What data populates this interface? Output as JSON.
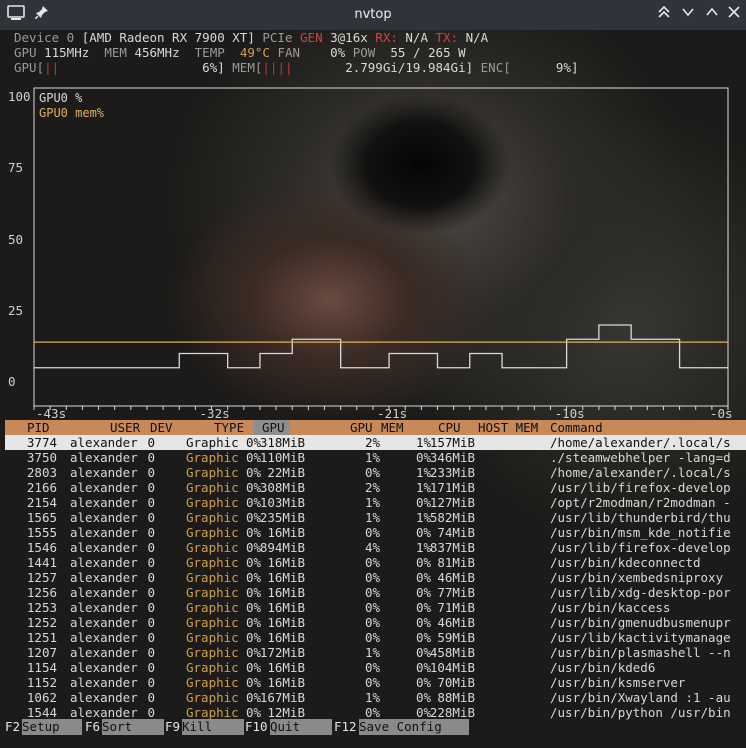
{
  "window": {
    "title": "nvtop"
  },
  "device": {
    "line1": {
      "device": "Device 0",
      "name": "[AMD Radeon RX 7900 XT]",
      "pcie_label": "PCIe",
      "gen_label": "GEN",
      "gen": "3@16x",
      "rx_label": "RX:",
      "rx": "N/A",
      "tx_label": "TX:",
      "tx": "N/A"
    },
    "line2": {
      "gpu_label": "GPU",
      "gpu_clock": "115MHz",
      "mem_label": "MEM",
      "mem_clock": "456MHz",
      "temp_label": "TEMP",
      "temp": "49°C",
      "fan_label": "FAN",
      "fan": "0%",
      "pow_label": "POW",
      "pow": "55 / 265 W"
    },
    "line3": {
      "gpu_label": "GPU[",
      "gpu_bar": "||",
      "gpu_pct": "6%]",
      "mem_label": "MEM[",
      "mem_bar": "||||",
      "mem_val": "2.799Gi/19.984Gi]",
      "enc_label": "ENC[",
      "enc_pct": "9%]"
    }
  },
  "chart_data": {
    "type": "line",
    "y_ticks": [
      "100",
      "75",
      "50",
      "25",
      "0"
    ],
    "x_ticks": [
      "-43s",
      "-32s",
      "-21s",
      "-10s",
      "-0s"
    ],
    "ylim": [
      0,
      100
    ],
    "series": [
      {
        "name": "GPU0 %",
        "color": "#d9d9d9",
        "x": [
          -43,
          -35,
          -34,
          -32,
          -31,
          -30,
          -29,
          -28,
          -27,
          -25,
          -24,
          -22,
          -21,
          -19,
          -18,
          -17,
          -16,
          -15,
          -14,
          -12,
          -10,
          -9,
          -8,
          -7,
          -6,
          -4,
          -3,
          0
        ],
        "values": [
          5,
          5,
          10,
          10,
          5,
          5,
          10,
          10,
          15,
          15,
          5,
          5,
          10,
          10,
          5,
          5,
          10,
          10,
          5,
          5,
          15,
          15,
          20,
          20,
          15,
          15,
          5,
          5
        ]
      },
      {
        "name": "GPU0 mem%",
        "color": "#e0b060",
        "x": [
          -43,
          0
        ],
        "values": [
          14,
          14
        ]
      }
    ]
  },
  "table": {
    "headers": {
      "pid": "PID",
      "user": "USER",
      "dev": "DEV",
      "type": "TYPE",
      "gpu": "GPU",
      "gpu_mem": "GPU",
      "mem": "MEM",
      "cpu": "CPU",
      "host_mem": "HOST MEM",
      "command": "Command"
    },
    "rows": [
      {
        "pid": "3774",
        "user": "alexander",
        "dev": "0",
        "type": "Graphic",
        "gpu": "0%",
        "gpu_mem": "318MiB",
        "mem": "2%",
        "cpu": "1%",
        "host_mem": "157MiB",
        "command": "/home/alexander/.local/s"
      },
      {
        "pid": "3750",
        "user": "alexander",
        "dev": "0",
        "type": "Graphic",
        "gpu": "0%",
        "gpu_mem": "110MiB",
        "mem": "1%",
        "cpu": "0%",
        "host_mem": "346MiB",
        "command": "./steamwebhelper -lang=d"
      },
      {
        "pid": "2803",
        "user": "alexander",
        "dev": "0",
        "type": "Graphic",
        "gpu": "0%",
        "gpu_mem": "22MiB",
        "mem": "0%",
        "cpu": "1%",
        "host_mem": "233MiB",
        "command": "/home/alexander/.local/s"
      },
      {
        "pid": "2166",
        "user": "alexander",
        "dev": "0",
        "type": "Graphic",
        "gpu": "0%",
        "gpu_mem": "308MiB",
        "mem": "2%",
        "cpu": "1%",
        "host_mem": "171MiB",
        "command": "/usr/lib/firefox-develop"
      },
      {
        "pid": "2154",
        "user": "alexander",
        "dev": "0",
        "type": "Graphic",
        "gpu": "0%",
        "gpu_mem": "103MiB",
        "mem": "1%",
        "cpu": "0%",
        "host_mem": "127MiB",
        "command": "/opt/r2modman/r2modman -"
      },
      {
        "pid": "1565",
        "user": "alexander",
        "dev": "0",
        "type": "Graphic",
        "gpu": "0%",
        "gpu_mem": "235MiB",
        "mem": "1%",
        "cpu": "1%",
        "host_mem": "582MiB",
        "command": "/usr/lib/thunderbird/thu"
      },
      {
        "pid": "1555",
        "user": "alexander",
        "dev": "0",
        "type": "Graphic",
        "gpu": "0%",
        "gpu_mem": "16MiB",
        "mem": "0%",
        "cpu": "0%",
        "host_mem": "74MiB",
        "command": "/usr/bin/msm_kde_notifie"
      },
      {
        "pid": "1546",
        "user": "alexander",
        "dev": "0",
        "type": "Graphic",
        "gpu": "0%",
        "gpu_mem": "894MiB",
        "mem": "4%",
        "cpu": "1%",
        "host_mem": "837MiB",
        "command": "/usr/lib/firefox-develop"
      },
      {
        "pid": "1441",
        "user": "alexander",
        "dev": "0",
        "type": "Graphic",
        "gpu": "0%",
        "gpu_mem": "16MiB",
        "mem": "0%",
        "cpu": "0%",
        "host_mem": "81MiB",
        "command": "/usr/bin/kdeconnectd"
      },
      {
        "pid": "1257",
        "user": "alexander",
        "dev": "0",
        "type": "Graphic",
        "gpu": "0%",
        "gpu_mem": "16MiB",
        "mem": "0%",
        "cpu": "0%",
        "host_mem": "46MiB",
        "command": "/usr/bin/xembedsniproxy"
      },
      {
        "pid": "1256",
        "user": "alexander",
        "dev": "0",
        "type": "Graphic",
        "gpu": "0%",
        "gpu_mem": "16MiB",
        "mem": "0%",
        "cpu": "0%",
        "host_mem": "77MiB",
        "command": "/usr/lib/xdg-desktop-por"
      },
      {
        "pid": "1253",
        "user": "alexander",
        "dev": "0",
        "type": "Graphic",
        "gpu": "0%",
        "gpu_mem": "16MiB",
        "mem": "0%",
        "cpu": "0%",
        "host_mem": "71MiB",
        "command": "/usr/bin/kaccess"
      },
      {
        "pid": "1252",
        "user": "alexander",
        "dev": "0",
        "type": "Graphic",
        "gpu": "0%",
        "gpu_mem": "16MiB",
        "mem": "0%",
        "cpu": "0%",
        "host_mem": "46MiB",
        "command": "/usr/bin/gmenudbusmenupr"
      },
      {
        "pid": "1251",
        "user": "alexander",
        "dev": "0",
        "type": "Graphic",
        "gpu": "0%",
        "gpu_mem": "16MiB",
        "mem": "0%",
        "cpu": "0%",
        "host_mem": "59MiB",
        "command": "/usr/lib/kactivitymanage"
      },
      {
        "pid": "1207",
        "user": "alexander",
        "dev": "0",
        "type": "Graphic",
        "gpu": "0%",
        "gpu_mem": "172MiB",
        "mem": "1%",
        "cpu": "0%",
        "host_mem": "458MiB",
        "command": "/usr/bin/plasmashell --n"
      },
      {
        "pid": "1154",
        "user": "alexander",
        "dev": "0",
        "type": "Graphic",
        "gpu": "0%",
        "gpu_mem": "16MiB",
        "mem": "0%",
        "cpu": "0%",
        "host_mem": "104MiB",
        "command": "/usr/bin/kded6"
      },
      {
        "pid": "1152",
        "user": "alexander",
        "dev": "0",
        "type": "Graphic",
        "gpu": "0%",
        "gpu_mem": "16MiB",
        "mem": "0%",
        "cpu": "0%",
        "host_mem": "70MiB",
        "command": "/usr/bin/ksmserver"
      },
      {
        "pid": "1062",
        "user": "alexander",
        "dev": "0",
        "type": "Graphic",
        "gpu": "0%",
        "gpu_mem": "167MiB",
        "mem": "1%",
        "cpu": "0%",
        "host_mem": "88MiB",
        "command": "/usr/bin/Xwayland :1 -au"
      },
      {
        "pid": "1544",
        "user": "alexander",
        "dev": "0",
        "type": "Graphic",
        "gpu": "0%",
        "gpu_mem": "12MiB",
        "mem": "0%",
        "cpu": "0%",
        "host_mem": "228MiB",
        "command": "/usr/bin/python /usr/bin"
      }
    ]
  },
  "footer": [
    {
      "key": "F2",
      "label": "Setup"
    },
    {
      "key": "F6",
      "label": "Sort"
    },
    {
      "key": "F9",
      "label": "Kill"
    },
    {
      "key": "F10",
      "label": "Quit"
    },
    {
      "key": "F12",
      "label": "Save Config"
    }
  ],
  "colors": {
    "header_bg": "#c7895a",
    "selected_row": "#e6e6e6",
    "graphic_type": "#d0a050",
    "gpu_bar": "#b03b3b"
  }
}
